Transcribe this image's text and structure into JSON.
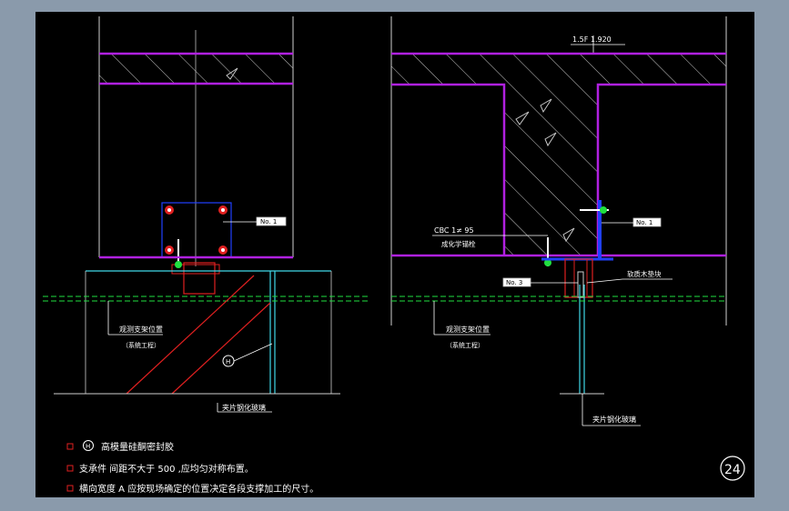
{
  "colors": {
    "frame_bg": "#8a9aab",
    "paper": "#000000",
    "slab": "#b020e0",
    "hatch": "#c8c8c8",
    "glass": "#40d8e8",
    "red": "#e02020",
    "blue": "#2040ff",
    "green": "#20e040",
    "text": "#ffffff"
  },
  "elevation": {
    "text": "1.5F  1.920"
  },
  "left_view": {
    "tag": "No. 1",
    "install_label": "观测支架位置",
    "install_sub": "（系统工程）",
    "glass_label": "夹片钢化玻璃",
    "circle_mark": "H"
  },
  "right_view": {
    "tag_top": "No. 1",
    "anchor_spec": "CBC  1≠      95",
    "anchor_label": "成化学锚栓",
    "tag_mid": "No. 3",
    "gasket_label": "软质木垫块",
    "install_label": "观测支架位置",
    "install_sub": "（系统工程）",
    "glass_label": "夹片钢化玻璃"
  },
  "notes": [
    {
      "mark": "H",
      "text": "高模量硅酮密封胶"
    },
    {
      "text": "支承件 间距不大于 500 ,应均匀对称布置。"
    },
    {
      "text": "横向宽度 A 应按现场确定的位置决定各段支撑加工的尺寸。"
    }
  ],
  "sheet_number": "24"
}
